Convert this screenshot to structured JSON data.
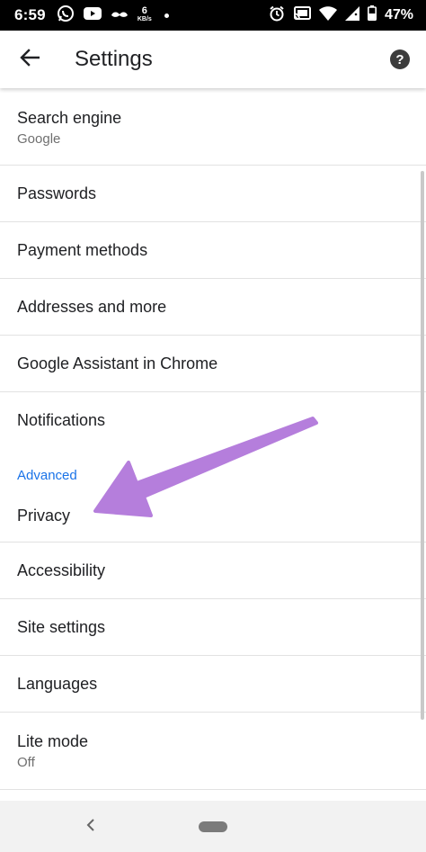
{
  "status_bar": {
    "time": "6:59",
    "net_speed_value": "6",
    "net_speed_unit": "KB/s",
    "battery": "47%",
    "icons": [
      "whatsapp-icon",
      "youtube-icon",
      "mustache-icon",
      "alarm-icon",
      "cast-icon",
      "wifi-icon",
      "signal-icon",
      "battery-icon"
    ]
  },
  "app_bar": {
    "title": "Settings"
  },
  "items": [
    {
      "title": "Search engine",
      "subtitle": "Google"
    },
    {
      "title": "Passwords"
    },
    {
      "title": "Payment methods"
    },
    {
      "title": "Addresses and more"
    },
    {
      "title": "Google Assistant in Chrome"
    },
    {
      "title": "Notifications"
    },
    {
      "title": "Privacy"
    },
    {
      "title": "Accessibility"
    },
    {
      "title": "Site settings"
    },
    {
      "title": "Languages"
    },
    {
      "title": "Lite mode",
      "subtitle": "Off"
    }
  ],
  "section_header": "Advanced",
  "colors": {
    "accent": "#1a73e8",
    "annotation_arrow": "#b57edc",
    "status_bar": "#000000"
  }
}
